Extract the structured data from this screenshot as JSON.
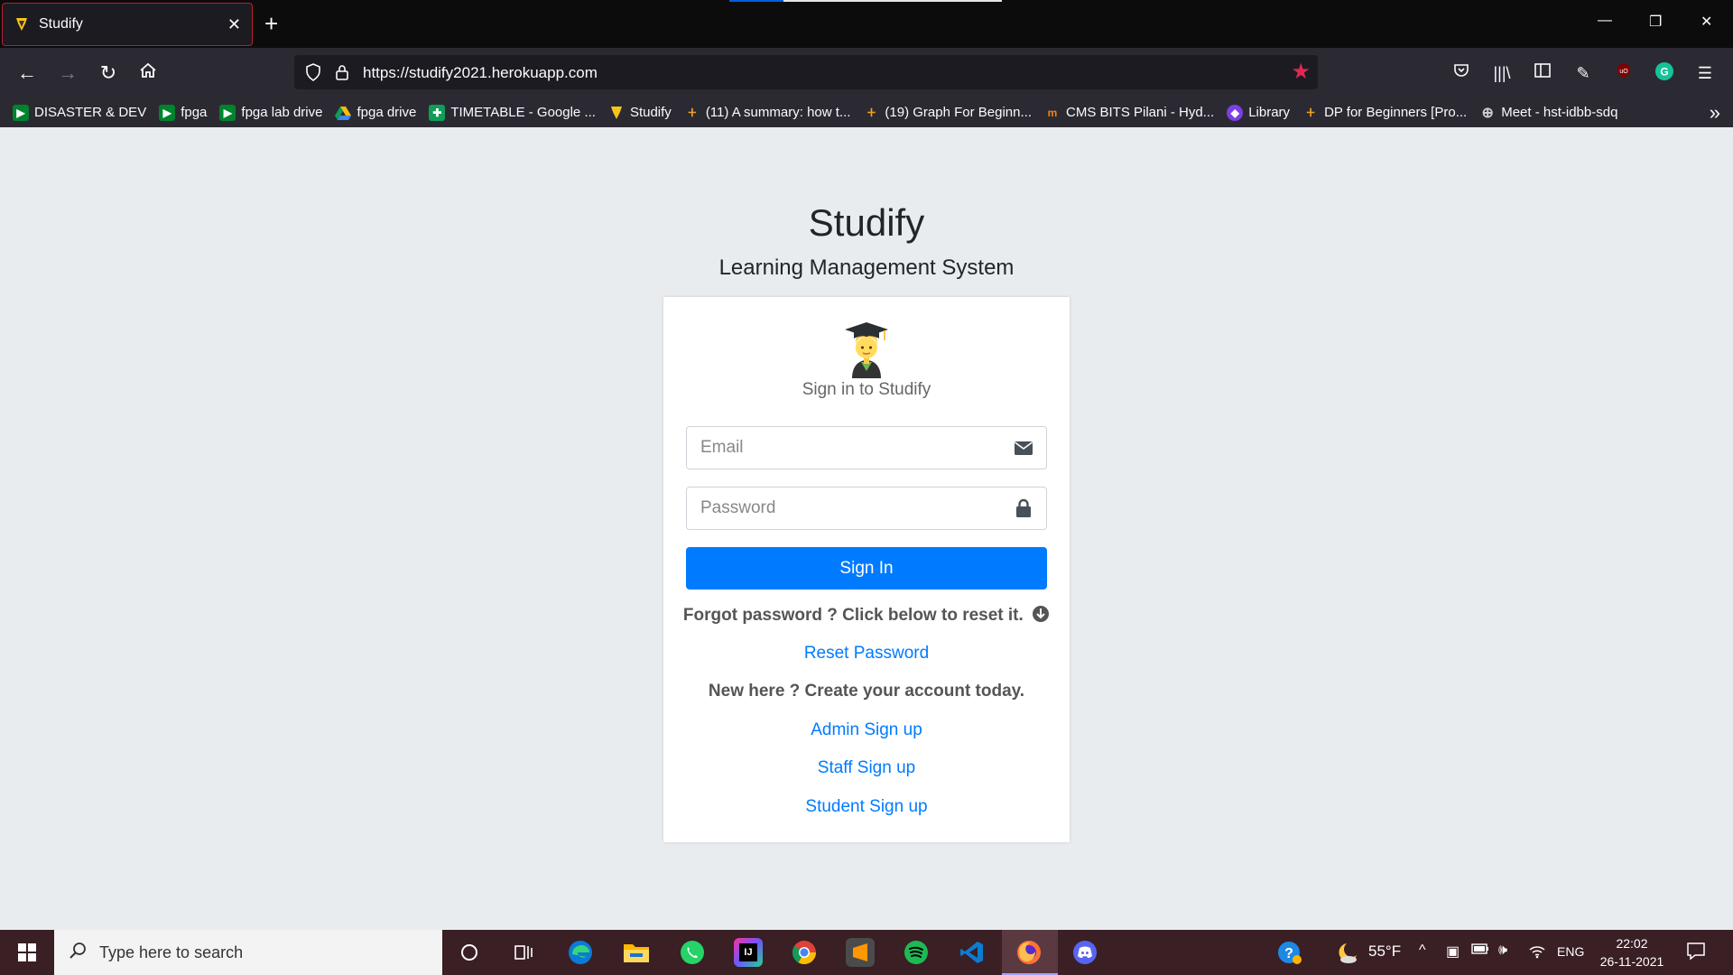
{
  "browser": {
    "tab_title": "Studify",
    "url": "https://studify2021.herokuapp.com",
    "bookmarks": [
      {
        "label": "DISASTER & DEV",
        "icon": "meet-icon",
        "color": "#00832d"
      },
      {
        "label": "fpga",
        "icon": "meet-icon",
        "color": "#00832d"
      },
      {
        "label": "fpga lab drive",
        "icon": "meet-icon",
        "color": "#00832d"
      },
      {
        "label": "fpga drive",
        "icon": "drive-icon",
        "color": "#fbbc04"
      },
      {
        "label": "TIMETABLE - Google ...",
        "icon": "sheets-icon",
        "color": "#0f9d58"
      },
      {
        "label": "Studify",
        "icon": "studify-icon",
        "color": "#f5c518"
      },
      {
        "label": "(11) A summary: how t...",
        "icon": "codeforces-icon",
        "color": "#f0a020"
      },
      {
        "label": "(19) Graph For Beginn...",
        "icon": "codeforces-icon",
        "color": "#f0a020"
      },
      {
        "label": "CMS BITS Pilani - Hyd...",
        "icon": "moodle-icon",
        "color": "#f98012"
      },
      {
        "label": "Library",
        "icon": "library-icon",
        "color": "#7b3fe4"
      },
      {
        "label": "DP for Beginners [Pro...",
        "icon": "codeforces-icon",
        "color": "#f0a020"
      },
      {
        "label": "Meet - hst-idbb-sdq",
        "icon": "globe-icon",
        "color": "#cccccc"
      }
    ]
  },
  "page": {
    "brand_name": "Studify",
    "brand_sub": "Learning Management System",
    "signin_msg": "Sign in to Studify",
    "email_placeholder": "Email",
    "password_placeholder": "Password",
    "signin_label": "Sign In",
    "forgot_text": "Forgot password ? Click below to reset it.",
    "reset_link": "Reset Password",
    "new_text": "New here ? Create your account today.",
    "admin_link": "Admin Sign up",
    "staff_link": "Staff Sign up",
    "student_link": "Student Sign up",
    "accent_color": "#007bff"
  },
  "taskbar": {
    "search_placeholder": "Type here to search",
    "weather": "55°F",
    "language": "ENG",
    "time": "22:02",
    "date": "26-11-2021"
  }
}
